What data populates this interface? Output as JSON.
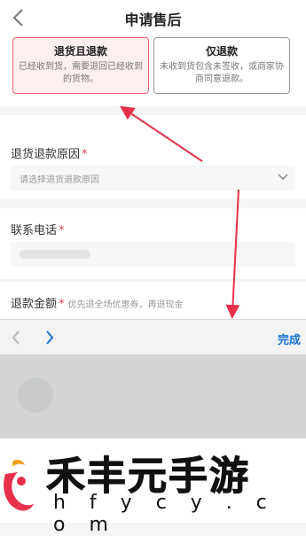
{
  "header": {
    "title": "申请售后",
    "back_icon": "chevron-left-icon"
  },
  "options": [
    {
      "title": "退货且退款",
      "desc": "已经收到货，需要退回已经收到的货物。",
      "selected": true
    },
    {
      "title": "仅退款",
      "desc": "未收到货包含未签收，或商家协商同意退款。",
      "selected": false
    }
  ],
  "form": {
    "reason_label": "退货退款原因",
    "reason_required": "*",
    "reason_placeholder": "请选择退货退款原因",
    "phone_label": "联系电话",
    "phone_required": "*",
    "amount_label": "退款金额",
    "amount_required": "*",
    "amount_hint": "优先退全场优惠券，再退现金"
  },
  "toolbar": {
    "prev_icon": "chevron-left-icon",
    "next_icon": "chevron-right-icon",
    "done_label": "完成"
  },
  "watermark": {
    "brand": "禾丰元手游",
    "url": "h f y c y . c o m"
  },
  "colors": {
    "selected_border": "#f06473",
    "selected_bg": "#fdeff0",
    "required": "#e0455a",
    "accent": "#1a73d9",
    "arrow": "#e8304a"
  }
}
